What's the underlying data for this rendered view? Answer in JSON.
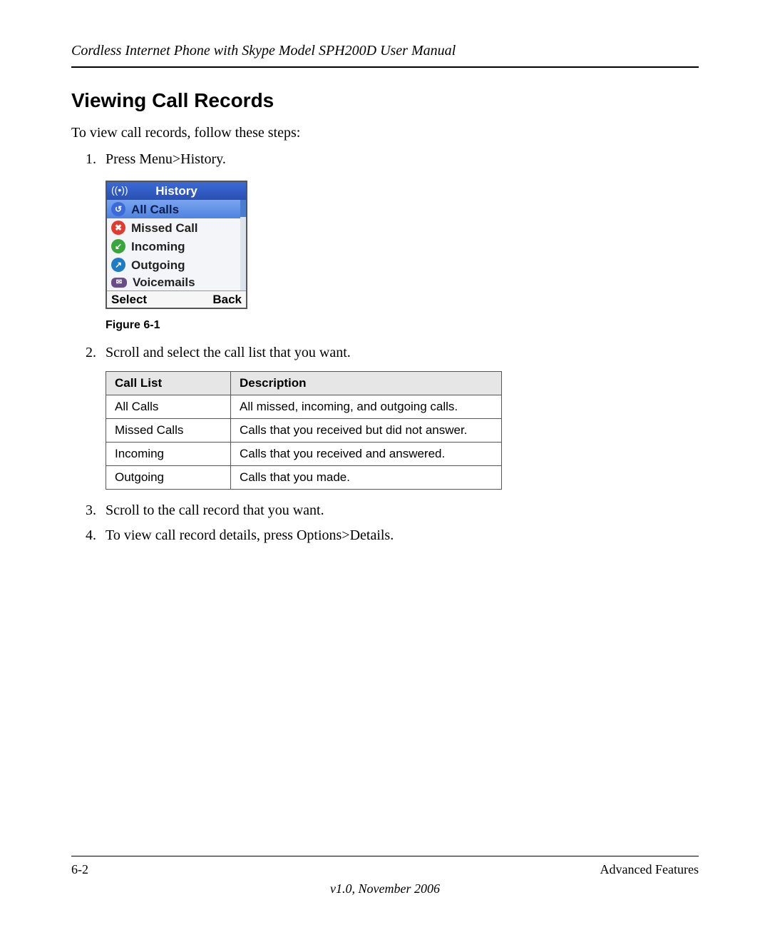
{
  "header": {
    "title": "Cordless Internet Phone with Skype Model SPH200D User Manual"
  },
  "section": {
    "title": "Viewing Call Records",
    "intro": "To view call records, follow these steps:"
  },
  "steps": [
    "Press Menu>History.",
    "Scroll and select the call list that you want.",
    "Scroll to the call record that you want.",
    "To view call record details, press Options>Details."
  ],
  "figure": {
    "caption": "Figure 6-1",
    "screen_title": "History",
    "items": [
      {
        "icon": "all",
        "label": "All Calls",
        "selected": true
      },
      {
        "icon": "missed",
        "label": "Missed Call",
        "selected": false
      },
      {
        "icon": "in",
        "label": "Incoming",
        "selected": false
      },
      {
        "icon": "out",
        "label": "Outgoing",
        "selected": false
      },
      {
        "icon": "vm",
        "label": "Voicemails",
        "selected": false
      }
    ],
    "soft_left": "Select",
    "soft_right": "Back"
  },
  "table": {
    "headers": {
      "col1": "Call List",
      "col2": "Description"
    },
    "rows": [
      {
        "c1": "All Calls",
        "c2": "All missed, incoming, and outgoing calls."
      },
      {
        "c1": "Missed Calls",
        "c2": "Calls that you received but did not answer."
      },
      {
        "c1": "Incoming",
        "c2": "Calls that you received and answered."
      },
      {
        "c1": "Outgoing",
        "c2": "Calls that you made."
      }
    ]
  },
  "footer": {
    "page": "6-2",
    "section": "Advanced Features",
    "version": "v1.0, November 2006"
  }
}
